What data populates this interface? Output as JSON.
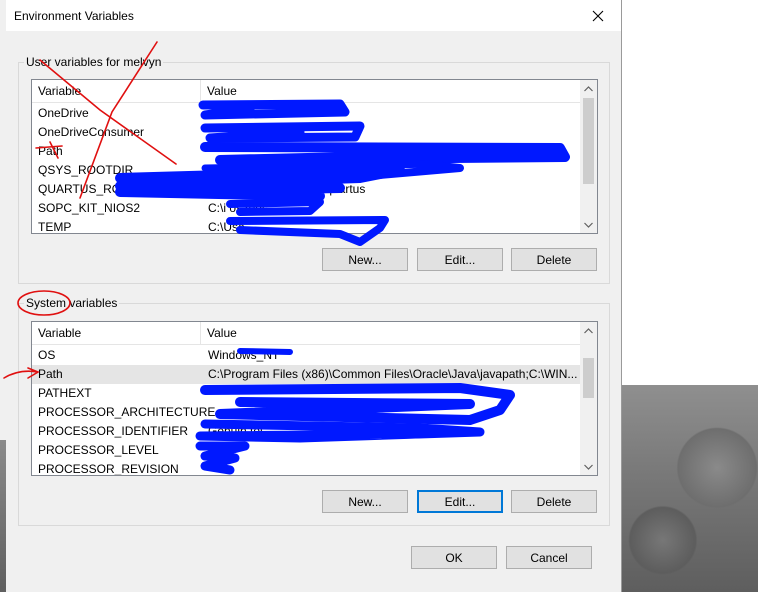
{
  "window": {
    "title": "Environment Variables"
  },
  "user_group": {
    "label": "User variables for melvyn",
    "columns": [
      "Variable",
      "Value"
    ],
    "rows": [
      {
        "name": "OneDrive",
        "value": ""
      },
      {
        "name": "OneDriveConsumer",
        "value": ""
      },
      {
        "name": "Path",
        "value": ""
      },
      {
        "name": "QSYS_ROOTDIR",
        "value": ""
      },
      {
        "name": "QUARTUS_ROO",
        "value": "\\quartus"
      },
      {
        "name": "SOPC_KIT_NIOS2",
        "value": "C:\\i                        os2eds"
      },
      {
        "name": "TEMP",
        "value": "C:\\Use"
      }
    ],
    "buttons": {
      "new": "New...",
      "edit": "Edit...",
      "delete": "Delete"
    }
  },
  "system_group": {
    "label": "System variables",
    "columns": [
      "Variable",
      "Value"
    ],
    "rows": [
      {
        "name": "OS",
        "value": "Windows_NT"
      },
      {
        "name": "Path",
        "value": "C:\\Program Files (x86)\\Common Files\\Oracle\\Java\\javapath;C:\\WIN..."
      },
      {
        "name": "PATHEXT",
        "value": ""
      },
      {
        "name": "PROCESSOR_ARCHITECTURE",
        "value": ""
      },
      {
        "name": "PROCESSOR_IDENTIFIER",
        "value": "                                        Genuin    tel"
      },
      {
        "name": "PROCESSOR_LEVEL",
        "value": ""
      },
      {
        "name": "PROCESSOR_REVISION",
        "value": ""
      }
    ],
    "selected_index": 1,
    "buttons": {
      "new": "New...",
      "edit": "Edit...",
      "delete": "Delete"
    }
  },
  "footer": {
    "ok": "OK",
    "cancel": "Cancel"
  },
  "colors": {
    "scribble_blue": "#0018ff",
    "annotation_red": "#e01010",
    "selection": "#e5e5e5"
  },
  "icons": {
    "close": "close-icon",
    "scroll_up": "chevron-up-icon",
    "scroll_down": "chevron-down-icon"
  }
}
